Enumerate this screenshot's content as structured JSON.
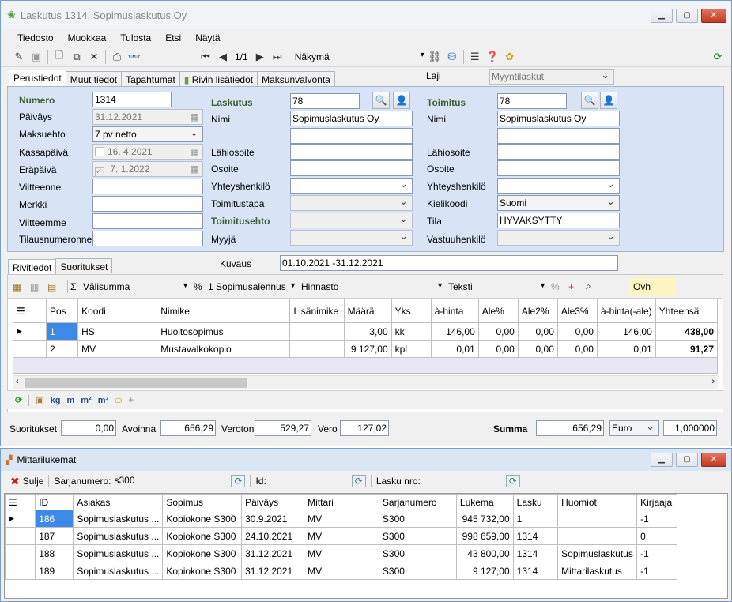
{
  "window": {
    "title": "Laskutus 1314, Sopimuslaskutus Oy",
    "min": "▁",
    "max": "▢",
    "close": "✕"
  },
  "menu": [
    "Tiedosto",
    "Muokkaa",
    "Tulosta",
    "Etsi",
    "Näytä"
  ],
  "toolbar": {
    "page": "1/1",
    "view_label": "Näkymä"
  },
  "tabs": [
    "Perustiedot",
    "Muut tiedot",
    "Tapahtumat",
    "Rivin lisätiedot",
    "Maksunvalvonta"
  ],
  "laji": {
    "label": "Laji",
    "value": "Myyntilaskut"
  },
  "form": {
    "numero_label": "Numero",
    "numero": "1314",
    "paivays_label": "Päiväys",
    "paivays": "31.12.2021",
    "maksuehto_label": "Maksuehto",
    "maksuehto": "7 pv netto",
    "kassapaiva_label": "Kassapäivä",
    "kassapaiva": "16.  4.2021",
    "erapaiva_label": "Eräpäivä",
    "erapaiva": "7.  1.2022",
    "viitteenne_label": "Viitteenne",
    "merkki_label": "Merkki",
    "viitteemme_label": "Viitteemme",
    "tilausnumeronne_label": "Tilausnumeronne",
    "laskutus_label": "Laskutus",
    "laskutus": "78",
    "nimi_label": "Nimi",
    "laskutus_nimi": "Sopimuslaskutus Oy",
    "lahiosoite_label": "Lähiosoite",
    "osoite_label": "Osoite",
    "yhteyshenkilo_label": "Yhteyshenkilö",
    "toimitustapa_label": "Toimitustapa",
    "toimitusehto_label": "Toimitusehto",
    "myyja_label": "Myyjä",
    "toimitus_label": "Toimitus",
    "toimitus": "78",
    "toimitus_nimi": "Sopimuslaskutus Oy",
    "kielikoodi_label": "Kielikoodi",
    "kielikoodi": "Suomi",
    "tila_label": "Tila",
    "tila": "HYVÄKSYTTY",
    "vastuuhenkilo_label": "Vastuuhenkilö"
  },
  "subtabs": [
    "Rivitiedot",
    "Suoritukset"
  ],
  "kuvaus": {
    "label": "Kuvaus",
    "value": "01.10.2021 -31.12.2021"
  },
  "gridtool": {
    "valisumma": "Välisumma",
    "pct": "%",
    "alennus": "1 Sopimusalennus",
    "hinnasto": "Hinnasto",
    "teksti": "Teksti",
    "ovh": "Ovh"
  },
  "rows_header": [
    "Pos",
    "Koodi",
    "Nimike",
    "Lisänimike",
    "Määrä",
    "Yks",
    "à-hinta",
    "Ale%",
    "Ale2%",
    "Ale3%",
    "à-hinta(-ale)",
    "Yhteensä"
  ],
  "rows": [
    [
      "1",
      "HS",
      "Huoltosopimus",
      "",
      "3,00",
      "kk",
      "146,00",
      "0,00",
      "0,00",
      "0,00",
      "146,00",
      "438,00"
    ],
    [
      "2",
      "MV",
      "Mustavalkokopio",
      "",
      "9 127,00",
      "kpl",
      "0,01",
      "0,00",
      "0,00",
      "0,00",
      "0,01",
      "91,27"
    ]
  ],
  "bottomtool": [
    "kg",
    "m",
    "m²",
    "m³"
  ],
  "summary": {
    "suoritukset_label": "Suoritukset",
    "suoritukset": "0,00",
    "avoinna_label": "Avoinna",
    "avoinna": "656,29",
    "veroton_label": "Veroton",
    "veroton": "529,27",
    "vero_label": "Vero",
    "vero": "127,02",
    "summa_label": "Summa",
    "summa": "656,29",
    "valuutta": "Euro",
    "kurssi": "1,000000"
  },
  "win2": {
    "title": "Mittarilukemat",
    "sulje": "Sulje",
    "sarjanumero_label": "Sarjanumero:",
    "sarjanumero": "s300",
    "id_label": "Id:",
    "lasku_label": "Lasku nro:",
    "headers": [
      "ID",
      "Asiakas",
      "Sopimus",
      "Päiväys",
      "Mittari",
      "Sarjanumero",
      "Lukema",
      "Lasku",
      "Huomiot",
      "Kirjaaja"
    ],
    "rows": [
      [
        "186",
        "Sopimuslaskutus ...",
        "Kopiokone S300",
        "30.9.2021",
        "MV",
        "S300",
        "945 732,00",
        "1",
        "",
        "-1"
      ],
      [
        "187",
        "Sopimuslaskutus ...",
        "Kopiokone S300",
        "24.10.2021",
        "MV",
        "S300",
        "998 659,00",
        "1314",
        "",
        "0"
      ],
      [
        "188",
        "Sopimuslaskutus ...",
        "Kopiokone S300",
        "31.12.2021",
        "MV",
        "S300",
        "43 800,00",
        "1314",
        "Sopimuslaskutus",
        "-1"
      ],
      [
        "189",
        "Sopimuslaskutus ...",
        "Kopiokone S300",
        "31.12.2021",
        "MV",
        "S300",
        "9 127,00",
        "1314",
        "Mittarilaskutus",
        "-1"
      ]
    ]
  }
}
